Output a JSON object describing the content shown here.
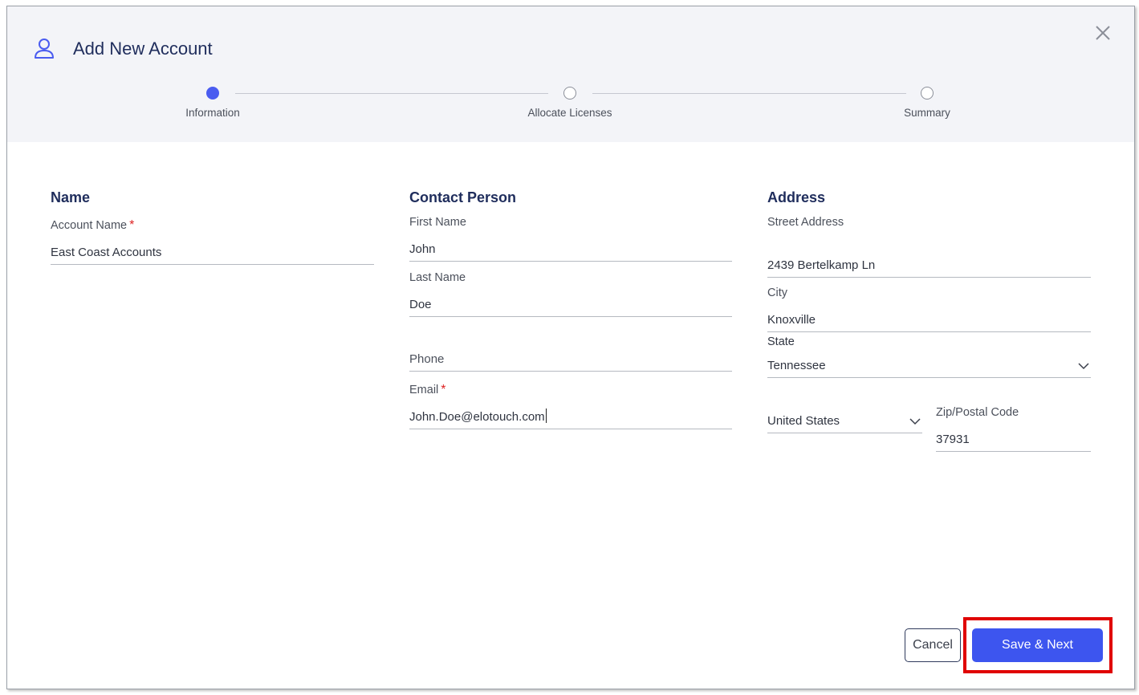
{
  "dialog": {
    "title": "Add New Account",
    "icon": "user-icon",
    "close_icon": "close-icon"
  },
  "stepper": {
    "steps": [
      {
        "label": "Information",
        "state": "active"
      },
      {
        "label": "Allocate Licenses",
        "state": "inactive"
      },
      {
        "label": "Summary",
        "state": "inactive"
      }
    ]
  },
  "name_section": {
    "title": "Name",
    "account_name_label": "Account Name",
    "required_mark": "*",
    "account_name_value": "East Coast Accounts"
  },
  "contact_section": {
    "title": "Contact Person",
    "first_name_label": "First Name",
    "first_name_value": "John",
    "last_name_label": "Last Name",
    "last_name_value": "Doe",
    "phone_label": "Phone",
    "phone_value": "",
    "email_label": "Email",
    "required_mark": "*",
    "email_value": "John.Doe@elotouch.com"
  },
  "address_section": {
    "title": "Address",
    "street_label": "Street Address",
    "street_value": "2439 Bertelkamp Ln",
    "city_label": "City",
    "city_value": "Knoxville",
    "state_label": "State",
    "state_value": "Tennessee",
    "country_value": "United States",
    "zip_label": "Zip/Postal Code",
    "zip_value": "37931"
  },
  "footer": {
    "cancel_label": "Cancel",
    "save_label": "Save & Next"
  },
  "colors": {
    "accent": "#3d55ef",
    "title": "#1f2d5c",
    "required": "#dd2222",
    "highlight": "#e00000",
    "header_bg": "#f3f4f8"
  }
}
